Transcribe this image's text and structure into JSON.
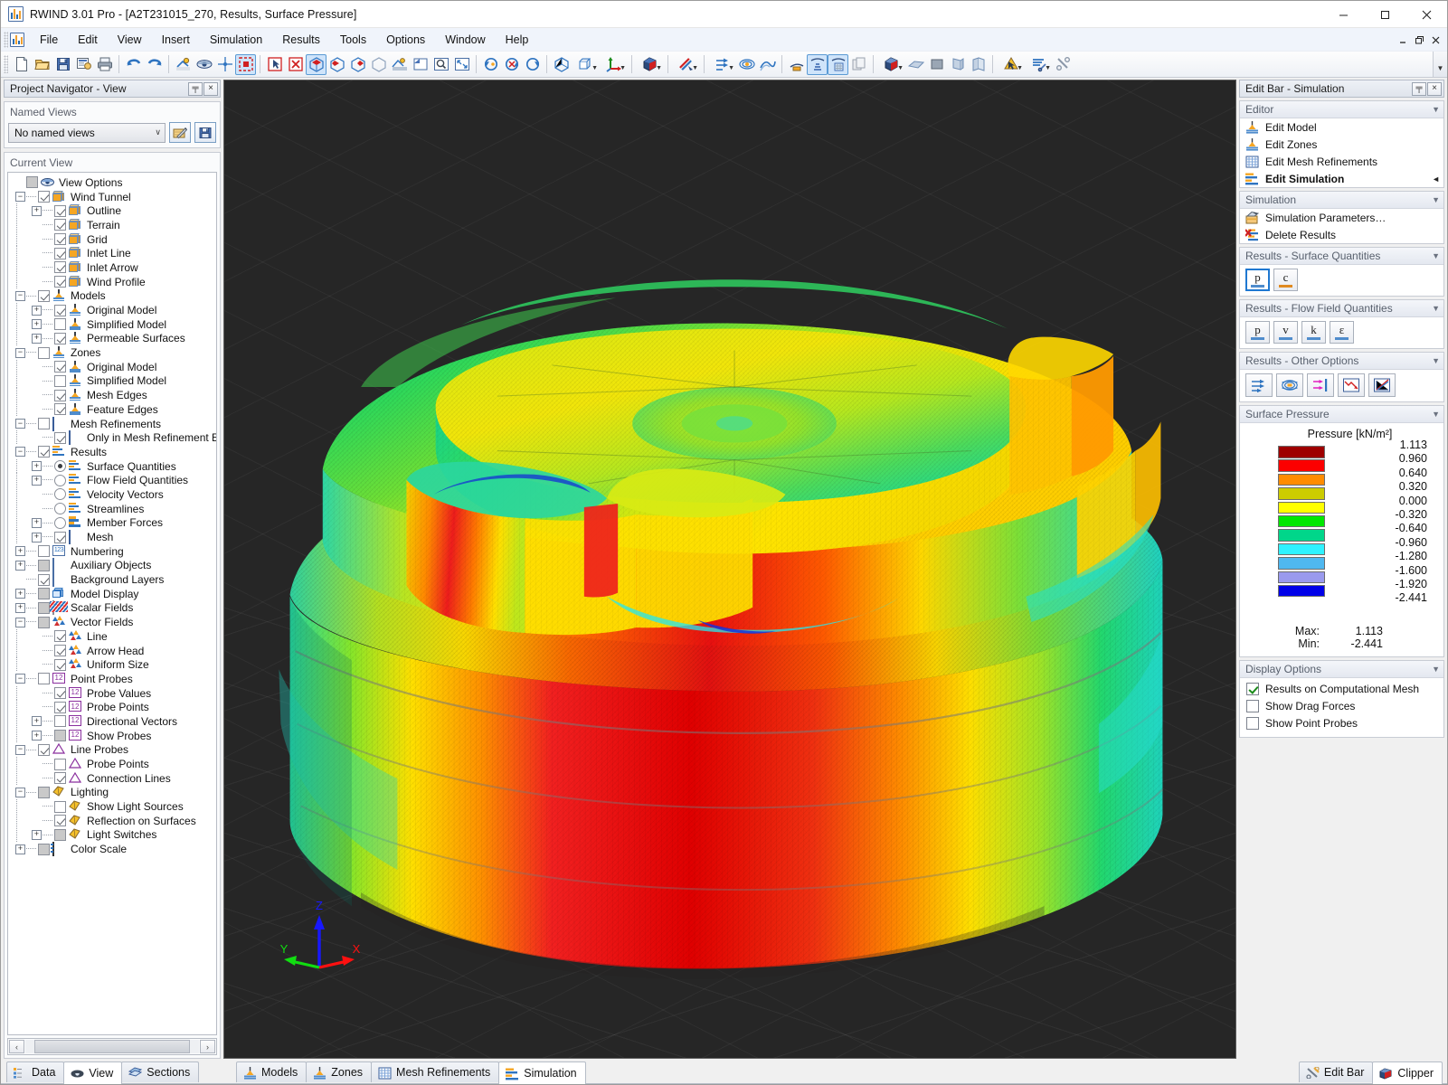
{
  "window": {
    "title": "RWIND 3.01 Pro - [A2T231015_270, Results, Surface Pressure]",
    "app_icon": "rwind-logo-icon",
    "minimize": "minimize-icon",
    "maximize": "maximize-icon",
    "close": "close-icon"
  },
  "menu": {
    "items": [
      {
        "label": "File"
      },
      {
        "label": "Edit"
      },
      {
        "label": "View"
      },
      {
        "label": "Insert"
      },
      {
        "label": "Simulation"
      },
      {
        "label": "Results"
      },
      {
        "label": "Tools"
      },
      {
        "label": "Options"
      },
      {
        "label": "Window"
      },
      {
        "label": "Help"
      }
    ],
    "mdi": {
      "restore": "mdi-restore-icon",
      "close": "mdi-close-icon"
    }
  },
  "toolbar": {
    "overflow_label": "▼",
    "groups": [
      {
        "buttons": [
          {
            "name": "new-file-icon",
            "kind": "page"
          },
          {
            "name": "open-file-icon",
            "kind": "folder"
          },
          {
            "name": "save-icon",
            "kind": "save"
          },
          {
            "name": "save-details-icon",
            "kind": "savedetails"
          },
          {
            "name": "print-icon",
            "kind": "printer"
          }
        ]
      },
      {
        "buttons": [
          {
            "name": "undo-icon",
            "kind": "undo"
          },
          {
            "name": "redo-icon",
            "kind": "redo"
          }
        ]
      },
      {
        "buttons": [
          {
            "name": "render-quality-icon",
            "kind": "render"
          },
          {
            "name": "visibility-icon",
            "kind": "eye"
          },
          {
            "name": "snap-icon",
            "kind": "snap"
          },
          {
            "name": "selection-box-icon",
            "kind": "selbox",
            "active": true
          }
        ]
      },
      {
        "buttons": [
          {
            "name": "select-objects-icon",
            "kind": "selectarrow"
          },
          {
            "name": "deselect-icon",
            "kind": "deselect"
          },
          {
            "name": "view-mode-1-icon",
            "kind": "viewmode",
            "active": true
          },
          {
            "name": "view-mode-2-icon",
            "kind": "viewmode2"
          },
          {
            "name": "view-mode-3-icon",
            "kind": "viewmode3"
          },
          {
            "name": "view-mode-4-icon",
            "kind": "viewmode4"
          },
          {
            "name": "shading-icon",
            "kind": "shading"
          },
          {
            "name": "zoom-window-icon",
            "kind": "zoomwin"
          },
          {
            "name": "zoom-detail-icon",
            "kind": "zoomdetail"
          },
          {
            "name": "zoom-all-icon",
            "kind": "zoomall"
          }
        ]
      },
      {
        "buttons": [
          {
            "name": "rotate-left-icon",
            "kind": "rotl"
          },
          {
            "name": "rotate-reset-icon",
            "kind": "rotreset"
          },
          {
            "name": "rotate-right-icon",
            "kind": "rotr"
          }
        ]
      },
      {
        "buttons": [
          {
            "name": "isometric-view-icon",
            "kind": "iso"
          },
          {
            "name": "projection-icon",
            "kind": "proj",
            "caret": true
          },
          {
            "name": "axis-view-icon",
            "kind": "axis",
            "caret": true
          }
        ]
      },
      {
        "buttons": [
          {
            "name": "display-style-icon",
            "kind": "cube3d",
            "caret": true
          }
        ]
      },
      {
        "buttons": [
          {
            "name": "color-scale-icon",
            "kind": "colorscale",
            "caret": true
          }
        ]
      },
      {
        "buttons": [
          {
            "name": "flow-arrows-icon",
            "kind": "flowarrows",
            "caret": true
          },
          {
            "name": "flow-field-icon",
            "kind": "flowfield"
          },
          {
            "name": "streamline-icon",
            "kind": "streamline"
          }
        ]
      },
      {
        "buttons": [
          {
            "name": "results-surface-icon",
            "kind": "ressurf"
          },
          {
            "name": "results-model-icon",
            "kind": "resmodel",
            "active": true
          },
          {
            "name": "results-mesh-icon",
            "kind": "resmesh",
            "active": true
          },
          {
            "name": "results-copy-icon",
            "kind": "rescopy"
          }
        ]
      },
      {
        "buttons": [
          {
            "name": "clipper-icon",
            "kind": "clipper",
            "caret": true
          },
          {
            "name": "plane-xy-icon",
            "kind": "planexy"
          },
          {
            "name": "plane-solid-icon",
            "kind": "planesolid"
          },
          {
            "name": "plane-yz-icon",
            "kind": "planeyz"
          },
          {
            "name": "plane-xz-icon",
            "kind": "planexz"
          }
        ]
      },
      {
        "buttons": [
          {
            "name": "section-tool-icon",
            "kind": "sectiontool",
            "caret": true
          },
          {
            "name": "settings-tool-icon",
            "kind": "settingstool",
            "caret": true
          },
          {
            "name": "tools-icon",
            "kind": "tools"
          }
        ]
      }
    ]
  },
  "left_panel": {
    "caption": "Project Navigator - View",
    "pin_label": "╤",
    "close_label": "×",
    "named_views": {
      "title": "Named Views",
      "selected": "No named views",
      "caret": "∨",
      "buttons": [
        {
          "name": "edit-named-views-button"
        },
        {
          "name": "save-named-view-button"
        }
      ]
    },
    "current_view": {
      "title": "Current View",
      "tree": [
        {
          "label": "View Options",
          "depth": 0,
          "exp": "none",
          "ctl": "cb-filled",
          "icon": "eye"
        },
        {
          "label": "Wind Tunnel",
          "depth": 1,
          "exp": "minus",
          "ctl": "cb-checked",
          "icon": "cube"
        },
        {
          "label": "Outline",
          "depth": 2,
          "exp": "plus",
          "ctl": "cb-checked",
          "icon": "cube"
        },
        {
          "label": "Terrain",
          "depth": 2,
          "exp": "none",
          "ctl": "cb-checked",
          "icon": "cube"
        },
        {
          "label": "Grid",
          "depth": 2,
          "exp": "none",
          "ctl": "cb-checked",
          "icon": "cube"
        },
        {
          "label": "Inlet Line",
          "depth": 2,
          "exp": "none",
          "ctl": "cb-checked",
          "icon": "cube"
        },
        {
          "label": "Inlet Arrow",
          "depth": 2,
          "exp": "none",
          "ctl": "cb-checked",
          "icon": "cube"
        },
        {
          "label": "Wind Profile",
          "depth": 2,
          "exp": "none",
          "ctl": "cb-checked",
          "icon": "cube"
        },
        {
          "label": "Models",
          "depth": 1,
          "exp": "minus",
          "ctl": "cb-checked",
          "icon": "support"
        },
        {
          "label": "Original Model",
          "depth": 2,
          "exp": "plus",
          "ctl": "cb-checked",
          "icon": "support"
        },
        {
          "label": "Simplified Model",
          "depth": 2,
          "exp": "plus",
          "ctl": "cb-empty",
          "icon": "support"
        },
        {
          "label": "Permeable Surfaces",
          "depth": 2,
          "exp": "plus",
          "ctl": "cb-checked",
          "icon": "support"
        },
        {
          "label": "Zones",
          "depth": 1,
          "exp": "minus",
          "ctl": "cb-empty",
          "icon": "support"
        },
        {
          "label": "Original Model",
          "depth": 2,
          "exp": "none",
          "ctl": "cb-checked",
          "icon": "support"
        },
        {
          "label": "Simplified Model",
          "depth": 2,
          "exp": "none",
          "ctl": "cb-empty",
          "icon": "support"
        },
        {
          "label": "Mesh Edges",
          "depth": 2,
          "exp": "none",
          "ctl": "cb-checked",
          "icon": "support"
        },
        {
          "label": "Feature Edges",
          "depth": 2,
          "exp": "none",
          "ctl": "cb-checked",
          "icon": "support"
        },
        {
          "label": "Mesh Refinements",
          "depth": 1,
          "exp": "minus",
          "ctl": "cb-empty",
          "icon": "grid"
        },
        {
          "label": "Only in Mesh Refinement Edito",
          "depth": 2,
          "exp": "none",
          "ctl": "cb-checked",
          "icon": "grid"
        },
        {
          "label": "Results",
          "depth": 1,
          "exp": "minus",
          "ctl": "cb-checked",
          "icon": "results"
        },
        {
          "label": "Surface Quantities",
          "depth": 2,
          "exp": "plus",
          "ctl": "radio-on",
          "icon": "results"
        },
        {
          "label": "Flow Field Quantities",
          "depth": 2,
          "exp": "plus",
          "ctl": "radio-off",
          "icon": "results"
        },
        {
          "label": "Velocity Vectors",
          "depth": 2,
          "exp": "none",
          "ctl": "radio-off",
          "icon": "results"
        },
        {
          "label": "Streamlines",
          "depth": 2,
          "exp": "none",
          "ctl": "radio-off",
          "icon": "results"
        },
        {
          "label": "Member Forces",
          "depth": 2,
          "exp": "plus",
          "ctl": "radio-off",
          "icon": "results"
        },
        {
          "label": "Mesh",
          "depth": 2,
          "exp": "plus",
          "ctl": "cb-checked",
          "icon": "grid"
        },
        {
          "label": "Numbering",
          "depth": 1,
          "exp": "plus",
          "ctl": "cb-empty",
          "icon": "num123"
        },
        {
          "label": "Auxiliary Objects",
          "depth": 1,
          "exp": "plus",
          "ctl": "cb-filled",
          "icon": "aux"
        },
        {
          "label": "Background Layers",
          "depth": 1,
          "exp": "none",
          "ctl": "cb-checked",
          "icon": "bg"
        },
        {
          "label": "Model Display",
          "depth": 1,
          "exp": "plus",
          "ctl": "cb-filled",
          "icon": "md"
        },
        {
          "label": "Scalar Fields",
          "depth": 1,
          "exp": "plus",
          "ctl": "cb-filled",
          "icon": "scalar"
        },
        {
          "label": "Vector Fields",
          "depth": 1,
          "exp": "minus",
          "ctl": "cb-filled",
          "icon": "vector"
        },
        {
          "label": "Line",
          "depth": 2,
          "exp": "none",
          "ctl": "cb-checked",
          "icon": "vector"
        },
        {
          "label": "Arrow Head",
          "depth": 2,
          "exp": "none",
          "ctl": "cb-checked",
          "icon": "vector"
        },
        {
          "label": "Uniform Size",
          "depth": 2,
          "exp": "none",
          "ctl": "cb-checked",
          "icon": "vector"
        },
        {
          "label": "Point Probes",
          "depth": 1,
          "exp": "minus",
          "ctl": "cb-empty",
          "icon": "probe"
        },
        {
          "label": "Probe Values",
          "depth": 2,
          "exp": "none",
          "ctl": "cb-checked",
          "icon": "probe"
        },
        {
          "label": "Probe Points",
          "depth": 2,
          "exp": "none",
          "ctl": "cb-checked",
          "icon": "probe"
        },
        {
          "label": "Directional Vectors",
          "depth": 2,
          "exp": "plus",
          "ctl": "cb-empty",
          "icon": "probe"
        },
        {
          "label": "Show Probes",
          "depth": 2,
          "exp": "plus",
          "ctl": "cb-filled",
          "icon": "probe"
        },
        {
          "label": "Line Probes",
          "depth": 1,
          "exp": "minus",
          "ctl": "cb-checked",
          "icon": "lineprobe"
        },
        {
          "label": "Probe Points",
          "depth": 2,
          "exp": "none",
          "ctl": "cb-empty",
          "icon": "lineprobe"
        },
        {
          "label": "Connection Lines",
          "depth": 2,
          "exp": "none",
          "ctl": "cb-checked",
          "icon": "lineprobe"
        },
        {
          "label": "Lighting",
          "depth": 1,
          "exp": "minus",
          "ctl": "cb-filled",
          "icon": "light"
        },
        {
          "label": "Show Light Sources",
          "depth": 2,
          "exp": "none",
          "ctl": "cb-empty",
          "icon": "light"
        },
        {
          "label": "Reflection on Surfaces",
          "depth": 2,
          "exp": "none",
          "ctl": "cb-checked",
          "icon": "light"
        },
        {
          "label": "Light Switches",
          "depth": 2,
          "exp": "plus",
          "ctl": "cb-filled",
          "icon": "light"
        },
        {
          "label": "Color Scale",
          "depth": 1,
          "exp": "plus",
          "ctl": "cb-filled",
          "icon": "colorscale"
        }
      ]
    },
    "hscroll": {
      "left": "‹",
      "right": "›"
    }
  },
  "right_panel": {
    "caption": "Edit Bar - Simulation",
    "pin_label": "╤",
    "close_label": "×",
    "sections": [
      {
        "title": "Editor",
        "chev": "▼",
        "items": [
          {
            "label": "Edit Model",
            "icon": "support-icon"
          },
          {
            "label": "Edit Zones",
            "icon": "support-icon"
          },
          {
            "label": "Edit Mesh Refinements",
            "icon": "grid-icon"
          },
          {
            "label": "Edit Simulation",
            "icon": "results-icon",
            "bold": true,
            "marker": "◄"
          }
        ]
      },
      {
        "title": "Simulation",
        "chev": "▼",
        "items": [
          {
            "label": "Simulation Parameters…",
            "icon": "parameters-icon"
          },
          {
            "label": "Delete Results",
            "icon": "delete-results-icon"
          }
        ]
      }
    ],
    "surface_quantities": {
      "title": "Results - Surface Quantities",
      "chev": "▼",
      "buttons": [
        {
          "label": "p",
          "sub": "",
          "name": "pressure-button",
          "selected": true,
          "underline": "blue"
        },
        {
          "label": "c",
          "sub": "p",
          "name": "cp-button",
          "selected": false,
          "underline": "orange"
        }
      ]
    },
    "flow_field_quantities": {
      "title": "Results - Flow Field Quantities",
      "chev": "▼",
      "buttons": [
        {
          "label": "p",
          "name": "flow-pressure-button",
          "underline": "blue"
        },
        {
          "label": "v",
          "name": "flow-velocity-button",
          "underline": "blue"
        },
        {
          "label": "k",
          "name": "flow-k-button",
          "underline": "blue"
        },
        {
          "label": "ε",
          "name": "flow-epsilon-button",
          "underline": "blue"
        }
      ]
    },
    "other_options": {
      "title": "Results - Other Options",
      "chev": "▼",
      "buttons": [
        {
          "name": "velocity-vectors-button"
        },
        {
          "name": "streamlines-button"
        },
        {
          "name": "flow-lines-button"
        },
        {
          "name": "convergence-chart-button"
        },
        {
          "name": "diagram-button"
        }
      ]
    },
    "surface_pressure": {
      "title": "Surface Pressure",
      "chev": "▼",
      "legend_title": "Pressure [kN/m²]",
      "bands": [
        {
          "color": "#9e0000"
        },
        {
          "color": "#fc0000"
        },
        {
          "color": "#ff8c00"
        },
        {
          "color": "#cccc00"
        },
        {
          "color": "#ffff00"
        },
        {
          "color": "#00e800"
        },
        {
          "color": "#00d68a"
        },
        {
          "color": "#2ff2ff"
        },
        {
          "color": "#4fb8f0"
        },
        {
          "color": "#9a9aee"
        },
        {
          "color": "#0000e8"
        }
      ],
      "values": [
        "1.113",
        "0.960",
        "0.640",
        "0.320",
        "0.000",
        "-0.320",
        "-0.640",
        "-0.960",
        "-1.280",
        "-1.600",
        "-1.920",
        "-2.441"
      ],
      "max_label": "Max:",
      "max_value": "1.113",
      "min_label": "Min:",
      "min_value": "-2.441"
    },
    "display_options": {
      "title": "Display Options",
      "chev": "▼",
      "items": [
        {
          "label": "Results on Computational Mesh",
          "checked": true
        },
        {
          "label": "Show Drag Forces",
          "checked": false
        },
        {
          "label": "Show Point Probes",
          "checked": false
        }
      ]
    }
  },
  "viewport": {
    "axes": {
      "x": "X",
      "y": "Y",
      "z": "Z",
      "x_color": "#ff1010",
      "y_color": "#11dd11",
      "z_color": "#1818ff"
    },
    "background": "#262626"
  },
  "bottom_tabs": {
    "left": [
      {
        "label": "Data",
        "icon": "data-icon",
        "active": false
      },
      {
        "label": "View",
        "icon": "view-icon",
        "active": true
      },
      {
        "label": "Sections",
        "icon": "sections-icon",
        "active": false
      }
    ],
    "middle": [
      {
        "label": "Models",
        "icon": "support-icon",
        "active": false
      },
      {
        "label": "Zones",
        "icon": "support-icon",
        "active": false
      },
      {
        "label": "Mesh Refinements",
        "icon": "grid-icon",
        "active": false
      },
      {
        "label": "Simulation",
        "icon": "results-icon",
        "active": true
      }
    ],
    "right": [
      {
        "label": "Edit Bar",
        "icon": "tools-icon",
        "active": false
      },
      {
        "label": "Clipper",
        "icon": "clipper-icon",
        "active": true
      }
    ]
  }
}
